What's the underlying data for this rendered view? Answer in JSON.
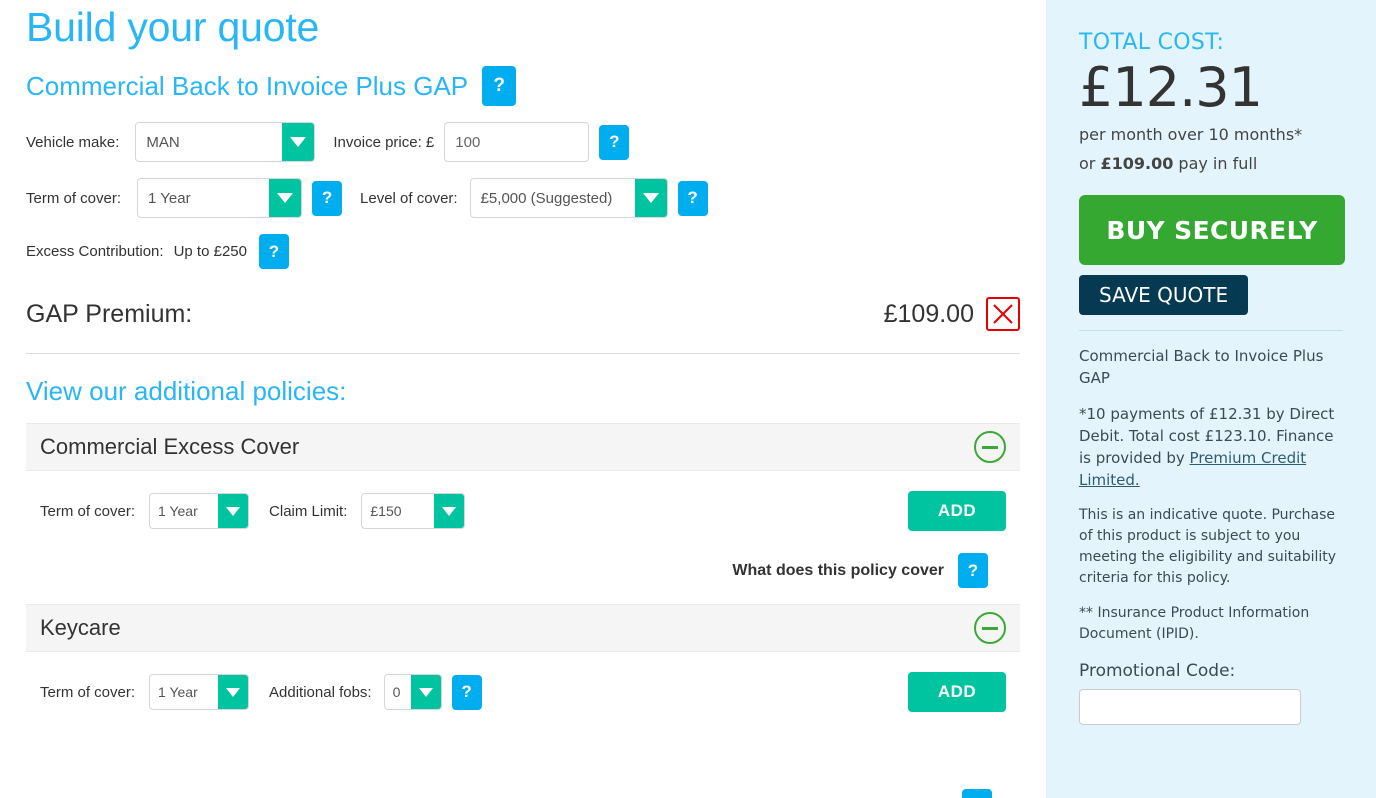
{
  "colors": {
    "accent_blue": "#29b6f6",
    "help_blue": "#00adef",
    "teal": "#00c4a0",
    "green": "#35a832",
    "navy": "#063a53",
    "red": "#e60000",
    "sidebar_bg": "#e3f4fc",
    "collapse_green": "#3ba935"
  },
  "main": {
    "page_title": "Build your quote",
    "product_title": "Commercial Back to Invoice Plus GAP",
    "product_help_label": "?",
    "fields": {
      "vehicle_make": {
        "label": "Vehicle make:",
        "value": "MAN"
      },
      "invoice_price": {
        "label": "Invoice price: £",
        "value": "100",
        "placeholder": "100",
        "help_label": "?"
      },
      "term_of_cover": {
        "label": "Term of cover:",
        "value": "1 Year",
        "help_label": "?"
      },
      "level_of_cover": {
        "label": "Level of cover:",
        "value": "£5,000 (Suggested)",
        "help_label": "?"
      },
      "excess_contribution": {
        "label": "Excess Contribution:",
        "value": "Up to £250",
        "help_label": "?"
      }
    },
    "premium": {
      "label": "GAP Premium:",
      "value": "£109.00",
      "remove_icon": "close-cross-icon"
    },
    "additional_policies_title": "View our additional policies:",
    "policies": [
      {
        "name": "Commercial Excess Cover",
        "collapse_icon": "minus-circle-icon",
        "controls": [
          {
            "label": "Term of cover:",
            "value": "1 Year",
            "type": "select"
          },
          {
            "label": "Claim Limit:",
            "value": "£150",
            "type": "select"
          }
        ],
        "add_label": "ADD",
        "cover_text": "What does this policy cover",
        "cover_help_label": "?"
      },
      {
        "name": "Keycare",
        "collapse_icon": "minus-circle-icon",
        "controls": [
          {
            "label": "Term of cover:",
            "value": "1 Year",
            "type": "select"
          },
          {
            "label": "Additional fobs:",
            "value": "0",
            "type": "select",
            "help_label": "?"
          }
        ],
        "add_label": "ADD"
      }
    ]
  },
  "sidebar": {
    "total_label": "TOTAL COST:",
    "total_amount": "£12.31",
    "per_month_text": "per month over 10 months*",
    "pay_full_prefix": "or ",
    "pay_full_amount": "£109.00",
    "pay_full_suffix": " pay in full",
    "buy_label": "BUY SECURELY",
    "save_label": "SAVE QUOTE",
    "product_name": "Commercial Back to Invoice Plus GAP",
    "finance_text_1": "*10 payments of £12.31 by Direct Debit. Total cost £123.10. Finance is provided by ",
    "finance_link": "Premium Credit Limited.",
    "indicative_text": "This is an indicative quote. Purchase of this product is subject to you meeting the eligibility and suitability criteria for this policy.",
    "ipid_text": "** Insurance Product Information Document (IPID).",
    "promo_label": "Promotional Code:",
    "promo_value": "",
    "promo_placeholder": ""
  }
}
